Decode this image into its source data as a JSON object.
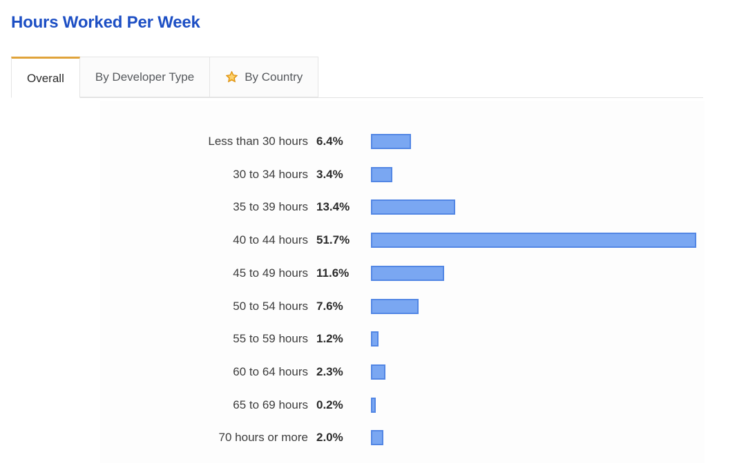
{
  "header": {
    "title": "Hours Worked Per Week",
    "title_color": "#1d4fc4"
  },
  "tabs": [
    {
      "id": "overall",
      "label": "Overall",
      "active": true,
      "icon": null
    },
    {
      "id": "by-developer-type",
      "label": "By Developer Type",
      "active": false,
      "icon": null
    },
    {
      "id": "by-country",
      "label": "By Country",
      "active": false,
      "icon": "star-icon"
    }
  ],
  "tab_accent_color": "#e0a33a",
  "chart_data": {
    "type": "bar",
    "orientation": "horizontal",
    "title": "Hours Worked Per Week",
    "xlabel": "",
    "ylabel": "",
    "xlim": [
      0,
      55
    ],
    "grid": false,
    "legend": false,
    "bar_fill_color": "#7aa7f2",
    "bar_border_color": "#5286e4",
    "categories": [
      "Less than 30 hours",
      "30 to 34 hours",
      "35 to 39 hours",
      "40 to 44 hours",
      "45 to 49 hours",
      "50 to 54 hours",
      "55 to 59 hours",
      "60 to 64 hours",
      "65 to 69 hours",
      "70 hours or more"
    ],
    "values": [
      6.4,
      3.4,
      13.4,
      51.7,
      11.6,
      7.6,
      1.2,
      2.3,
      0.2,
      2.0
    ],
    "value_labels": [
      "6.4%",
      "3.4%",
      "13.4%",
      "51.7%",
      "11.6%",
      "7.6%",
      "1.2%",
      "2.3%",
      "0.2%",
      "2.0%"
    ]
  }
}
